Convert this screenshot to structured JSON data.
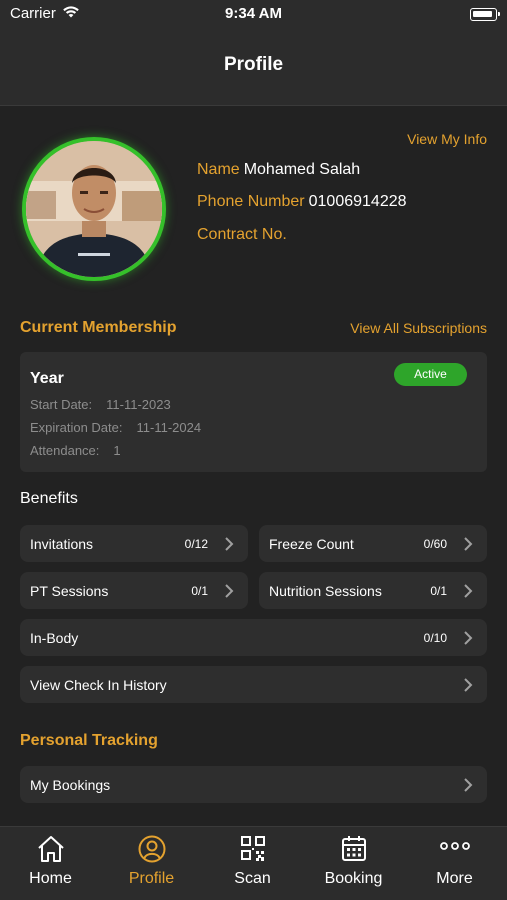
{
  "status_bar": {
    "carrier": "Carrier",
    "time": "9:34 AM"
  },
  "nav": {
    "title": "Profile"
  },
  "profile": {
    "view_info": "View My Info",
    "name_label": "Name",
    "name_value": "Mohamed Salah",
    "phone_label": "Phone Number",
    "phone_value": "01006914228",
    "contract_label": "Contract No.",
    "contract_value": "",
    "avatar_ring_color": "#35c02a"
  },
  "membership": {
    "section_title": "Current Membership",
    "view_all": "View All Subscriptions",
    "plan": "Year",
    "status": "Active",
    "start_label": "Start Date:",
    "start_value": "11-11-2023",
    "expiration_label": "Expiration Date:",
    "expiration_value": "11-11-2024",
    "attendance_label": "Attendance:",
    "attendance_value": "1"
  },
  "benefits": {
    "title": "Benefits",
    "items": [
      {
        "label": "Invitations",
        "count": "0/12"
      },
      {
        "label": "Freeze Count",
        "count": "0/60"
      },
      {
        "label": "PT Sessions",
        "count": "0/1"
      },
      {
        "label": "Nutrition Sessions",
        "count": "0/1"
      },
      {
        "label": "In-Body",
        "count": "0/10"
      },
      {
        "label": "View Check In History",
        "count": ""
      }
    ]
  },
  "tracking": {
    "title": "Personal Tracking",
    "items": [
      {
        "label": "My Bookings"
      }
    ]
  },
  "tabs": [
    {
      "label": "Home",
      "icon": "home-icon"
    },
    {
      "label": "Profile",
      "icon": "user-circle-icon",
      "active": true
    },
    {
      "label": "Scan",
      "icon": "qr-code-icon"
    },
    {
      "label": "Booking",
      "icon": "calendar-icon"
    },
    {
      "label": "More",
      "icon": "more-dots-icon"
    }
  ],
  "colors": {
    "accent": "#e4a22f",
    "active_badge": "#2ea52a",
    "background": "#222222",
    "card": "#2e2e2e"
  }
}
